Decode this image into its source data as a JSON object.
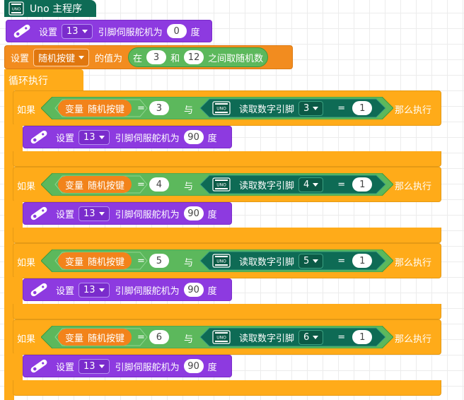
{
  "hat": {
    "label": "Uno 主程序",
    "board": "UNO"
  },
  "servo_set": {
    "label_set": "设置",
    "pin": "13",
    "label_mid": "引脚伺服舵机为",
    "angle": "0",
    "unit": "度"
  },
  "set_var": {
    "label_set": "设置",
    "var": "随机按键",
    "label_value": "的值为",
    "rand": {
      "label_in": "在",
      "min": "3",
      "label_and": "和",
      "max": "12",
      "label_tail": "之间取随机数"
    }
  },
  "loop": {
    "label": "循环执行"
  },
  "conditions": [
    {
      "label_if": "如果",
      "var_prefix": "变量",
      "var": "随机按键",
      "op": "=",
      "value": "3",
      "label_and": "与",
      "read_label": "读取数字引脚",
      "pin": "3",
      "eq": "=",
      "pin_value": "1",
      "label_then": "那么执行",
      "action": {
        "label_set": "设置",
        "pin": "13",
        "label_mid": "引脚伺服舵机为",
        "angle": "90",
        "unit": "度"
      }
    },
    {
      "label_if": "如果",
      "var_prefix": "变量",
      "var": "随机按键",
      "op": "=",
      "value": "4",
      "label_and": "与",
      "read_label": "读取数字引脚",
      "pin": "4",
      "eq": "=",
      "pin_value": "1",
      "label_then": "那么执行",
      "action": {
        "label_set": "设置",
        "pin": "13",
        "label_mid": "引脚伺服舵机为",
        "angle": "90",
        "unit": "度"
      }
    },
    {
      "label_if": "如果",
      "var_prefix": "变量",
      "var": "随机按键",
      "op": "=",
      "value": "5",
      "label_and": "与",
      "read_label": "读取数字引脚",
      "pin": "5",
      "eq": "=",
      "pin_value": "1",
      "label_then": "那么执行",
      "action": {
        "label_set": "设置",
        "pin": "13",
        "label_mid": "引脚伺服舵机为",
        "angle": "90",
        "unit": "度"
      }
    },
    {
      "label_if": "如果",
      "var_prefix": "变量",
      "var": "随机按键",
      "op": "=",
      "value": "6",
      "label_and": "与",
      "read_label": "读取数字引脚",
      "pin": "6",
      "eq": "=",
      "pin_value": "1",
      "label_then": "那么执行",
      "action": {
        "label_set": "设置",
        "pin": "13",
        "label_mid": "引脚伺服舵机为",
        "angle": "90",
        "unit": "度"
      }
    }
  ],
  "colors": {
    "hat": "#0e6b55",
    "servo": "#8d3ae0",
    "variable": "#f28c1f",
    "control": "#ffab19",
    "logic": "#5cb85c",
    "pin_read": "#0e6b55"
  },
  "icons": {
    "board": "arduino-board-icon",
    "servo": "servo-icon"
  }
}
